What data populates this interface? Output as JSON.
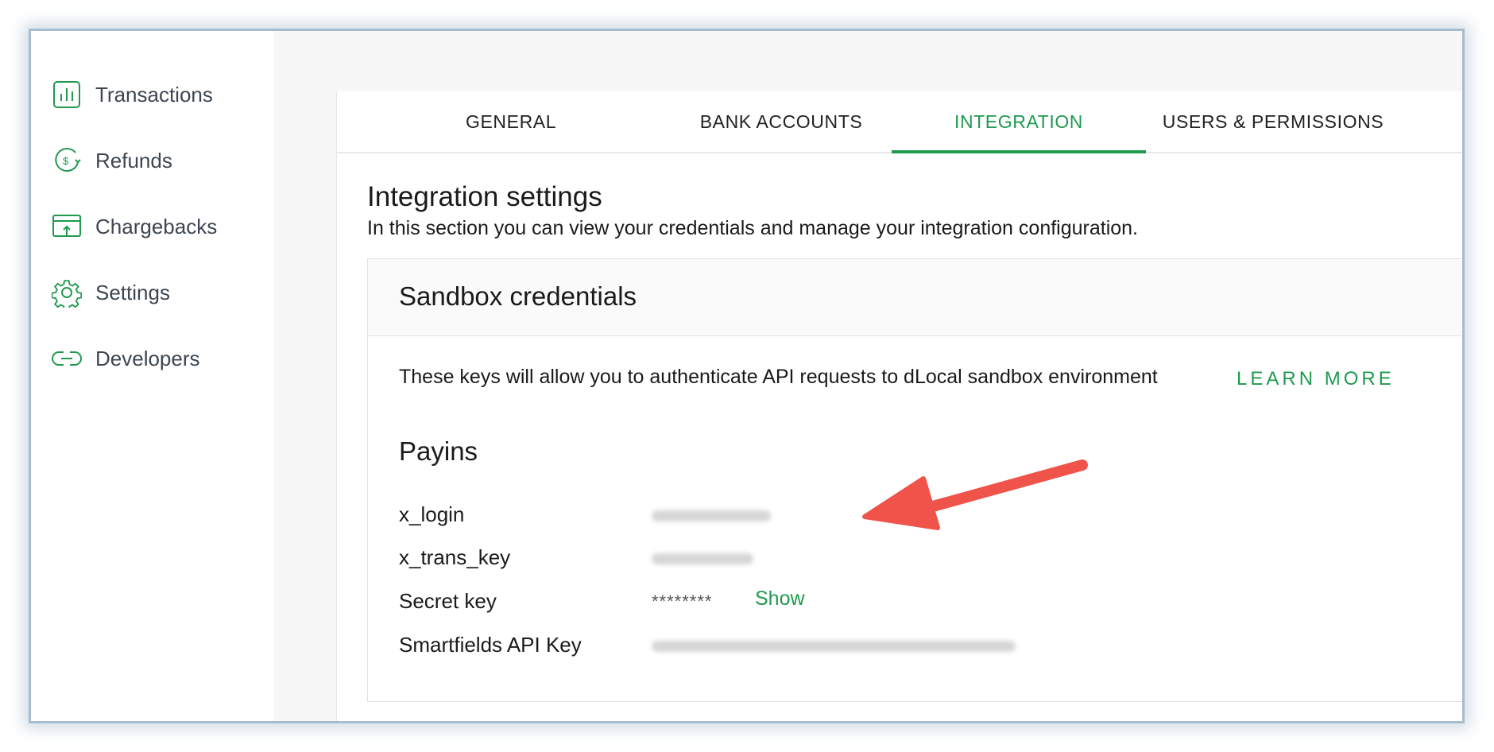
{
  "sidebar": {
    "items": [
      {
        "label": "Transactions",
        "icon": "bar-chart-icon"
      },
      {
        "label": "Refunds",
        "icon": "dollar-refund-icon"
      },
      {
        "label": "Chargebacks",
        "icon": "chargeback-icon"
      },
      {
        "label": "Settings",
        "icon": "gear-icon"
      },
      {
        "label": "Developers",
        "icon": "link-icon"
      }
    ]
  },
  "tabs": [
    {
      "label": "GENERAL"
    },
    {
      "label": "BANK ACCOUNTS"
    },
    {
      "label": "INTEGRATION",
      "active": true
    },
    {
      "label": "USERS & PERMISSIONS"
    }
  ],
  "page": {
    "title": "Integration settings",
    "subtitle": "In this section you can view your credentials and manage your integration configuration."
  },
  "sandbox": {
    "title": "Sandbox credentials",
    "description": "These keys will allow you to authenticate API requests to dLocal sandbox environment",
    "learn_more": "LEARN MORE",
    "payins_title": "Payins",
    "fields": [
      {
        "label": "x_login"
      },
      {
        "label": "x_trans_key"
      },
      {
        "label": "Secret key",
        "value": "********",
        "action": "Show"
      },
      {
        "label": "Smartfields API Key"
      }
    ]
  },
  "colors": {
    "accent": "#1f9a4f",
    "arrow": "#f0534a",
    "frame_border": "#a9bccc"
  }
}
